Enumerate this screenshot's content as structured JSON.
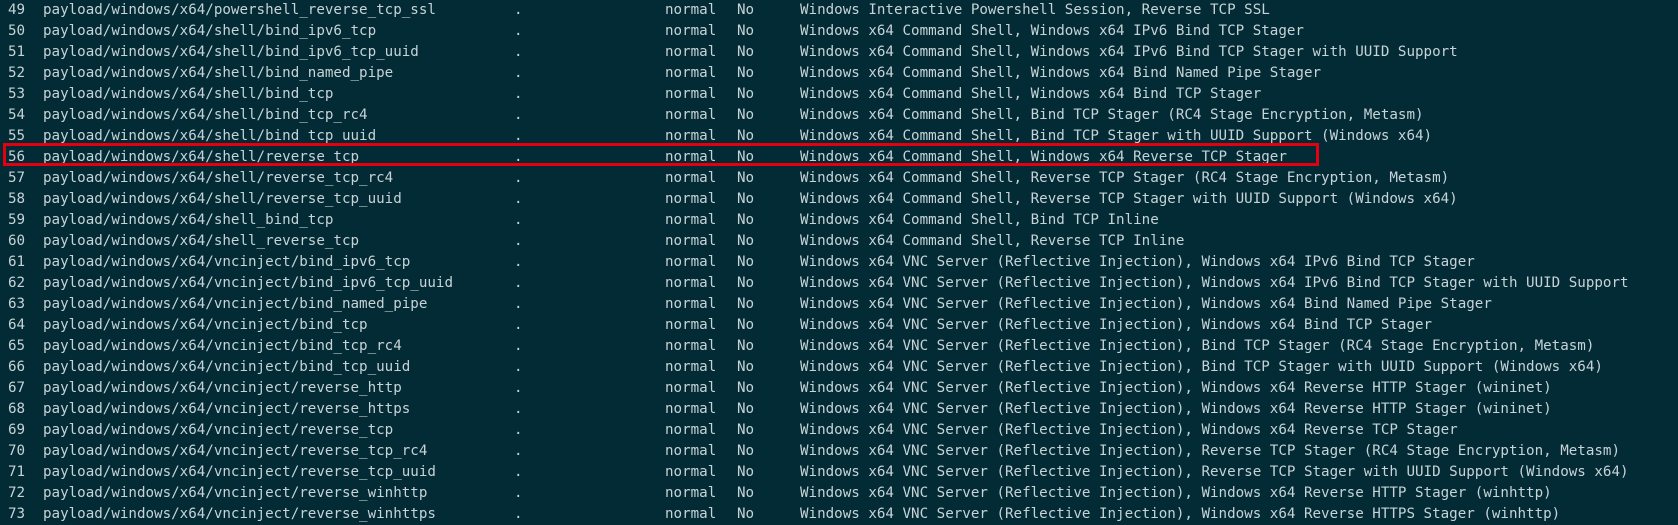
{
  "rows": [
    {
      "num": "49",
      "name": "payload/windows/x64/powershell_reverse_tcp_ssl",
      "date": ".",
      "rank": "normal",
      "check": "No",
      "desc": "Windows Interactive Powershell Session, Reverse TCP SSL"
    },
    {
      "num": "50",
      "name": "payload/windows/x64/shell/bind_ipv6_tcp",
      "date": ".",
      "rank": "normal",
      "check": "No",
      "desc": "Windows x64 Command Shell, Windows x64 IPv6 Bind TCP Stager"
    },
    {
      "num": "51",
      "name": "payload/windows/x64/shell/bind_ipv6_tcp_uuid",
      "date": ".",
      "rank": "normal",
      "check": "No",
      "desc": "Windows x64 Command Shell, Windows x64 IPv6 Bind TCP Stager with UUID Support"
    },
    {
      "num": "52",
      "name": "payload/windows/x64/shell/bind_named_pipe",
      "date": ".",
      "rank": "normal",
      "check": "No",
      "desc": "Windows x64 Command Shell, Windows x64 Bind Named Pipe Stager"
    },
    {
      "num": "53",
      "name": "payload/windows/x64/shell/bind_tcp",
      "date": ".",
      "rank": "normal",
      "check": "No",
      "desc": "Windows x64 Command Shell, Windows x64 Bind TCP Stager"
    },
    {
      "num": "54",
      "name": "payload/windows/x64/shell/bind_tcp_rc4",
      "date": ".",
      "rank": "normal",
      "check": "No",
      "desc": "Windows x64 Command Shell, Bind TCP Stager (RC4 Stage Encryption, Metasm)"
    },
    {
      "num": "55",
      "name": "payload/windows/x64/shell/bind_tcp_uuid",
      "date": ".",
      "rank": "normal",
      "check": "No",
      "desc": "Windows x64 Command Shell, Bind TCP Stager with UUID Support (Windows x64)"
    },
    {
      "num": "56",
      "name": "payload/windows/x64/shell/reverse_tcp",
      "date": ".",
      "rank": "normal",
      "check": "No",
      "desc": "Windows x64 Command Shell, Windows x64 Reverse TCP Stager",
      "highlighted": true
    },
    {
      "num": "57",
      "name": "payload/windows/x64/shell/reverse_tcp_rc4",
      "date": ".",
      "rank": "normal",
      "check": "No",
      "desc": "Windows x64 Command Shell, Reverse TCP Stager (RC4 Stage Encryption, Metasm)"
    },
    {
      "num": "58",
      "name": "payload/windows/x64/shell/reverse_tcp_uuid",
      "date": ".",
      "rank": "normal",
      "check": "No",
      "desc": "Windows x64 Command Shell, Reverse TCP Stager with UUID Support (Windows x64)"
    },
    {
      "num": "59",
      "name": "payload/windows/x64/shell_bind_tcp",
      "date": ".",
      "rank": "normal",
      "check": "No",
      "desc": "Windows x64 Command Shell, Bind TCP Inline"
    },
    {
      "num": "60",
      "name": "payload/windows/x64/shell_reverse_tcp",
      "date": ".",
      "rank": "normal",
      "check": "No",
      "desc": "Windows x64 Command Shell, Reverse TCP Inline"
    },
    {
      "num": "61",
      "name": "payload/windows/x64/vncinject/bind_ipv6_tcp",
      "date": ".",
      "rank": "normal",
      "check": "No",
      "desc": "Windows x64 VNC Server (Reflective Injection), Windows x64 IPv6 Bind TCP Stager"
    },
    {
      "num": "62",
      "name": "payload/windows/x64/vncinject/bind_ipv6_tcp_uuid",
      "date": ".",
      "rank": "normal",
      "check": "No",
      "desc": "Windows x64 VNC Server (Reflective Injection), Windows x64 IPv6 Bind TCP Stager with UUID Support"
    },
    {
      "num": "63",
      "name": "payload/windows/x64/vncinject/bind_named_pipe",
      "date": ".",
      "rank": "normal",
      "check": "No",
      "desc": "Windows x64 VNC Server (Reflective Injection), Windows x64 Bind Named Pipe Stager"
    },
    {
      "num": "64",
      "name": "payload/windows/x64/vncinject/bind_tcp",
      "date": ".",
      "rank": "normal",
      "check": "No",
      "desc": "Windows x64 VNC Server (Reflective Injection), Windows x64 Bind TCP Stager"
    },
    {
      "num": "65",
      "name": "payload/windows/x64/vncinject/bind_tcp_rc4",
      "date": ".",
      "rank": "normal",
      "check": "No",
      "desc": "Windows x64 VNC Server (Reflective Injection), Bind TCP Stager (RC4 Stage Encryption, Metasm)"
    },
    {
      "num": "66",
      "name": "payload/windows/x64/vncinject/bind_tcp_uuid",
      "date": ".",
      "rank": "normal",
      "check": "No",
      "desc": "Windows x64 VNC Server (Reflective Injection), Bind TCP Stager with UUID Support (Windows x64)"
    },
    {
      "num": "67",
      "name": "payload/windows/x64/vncinject/reverse_http",
      "date": ".",
      "rank": "normal",
      "check": "No",
      "desc": "Windows x64 VNC Server (Reflective Injection), Windows x64 Reverse HTTP Stager (wininet)"
    },
    {
      "num": "68",
      "name": "payload/windows/x64/vncinject/reverse_https",
      "date": ".",
      "rank": "normal",
      "check": "No",
      "desc": "Windows x64 VNC Server (Reflective Injection), Windows x64 Reverse HTTP Stager (wininet)"
    },
    {
      "num": "69",
      "name": "payload/windows/x64/vncinject/reverse_tcp",
      "date": ".",
      "rank": "normal",
      "check": "No",
      "desc": "Windows x64 VNC Server (Reflective Injection), Windows x64 Reverse TCP Stager"
    },
    {
      "num": "70",
      "name": "payload/windows/x64/vncinject/reverse_tcp_rc4",
      "date": ".",
      "rank": "normal",
      "check": "No",
      "desc": "Windows x64 VNC Server (Reflective Injection), Reverse TCP Stager (RC4 Stage Encryption, Metasm)"
    },
    {
      "num": "71",
      "name": "payload/windows/x64/vncinject/reverse_tcp_uuid",
      "date": ".",
      "rank": "normal",
      "check": "No",
      "desc": "Windows x64 VNC Server (Reflective Injection), Reverse TCP Stager with UUID Support (Windows x64)"
    },
    {
      "num": "72",
      "name": "payload/windows/x64/vncinject/reverse_winhttp",
      "date": ".",
      "rank": "normal",
      "check": "No",
      "desc": "Windows x64 VNC Server (Reflective Injection), Windows x64 Reverse HTTP Stager (winhttp)"
    },
    {
      "num": "73",
      "name": "payload/windows/x64/vncinject/reverse_winhttps",
      "date": ".",
      "rank": "normal",
      "check": "No",
      "desc": "Windows x64 VNC Server (Reflective Injection), Windows x64 Reverse HTTPS Stager (winhttp)"
    }
  ],
  "colors": {
    "background": "#022b36",
    "text": "#c7d3d6",
    "highlight_border": "#e3000f"
  }
}
